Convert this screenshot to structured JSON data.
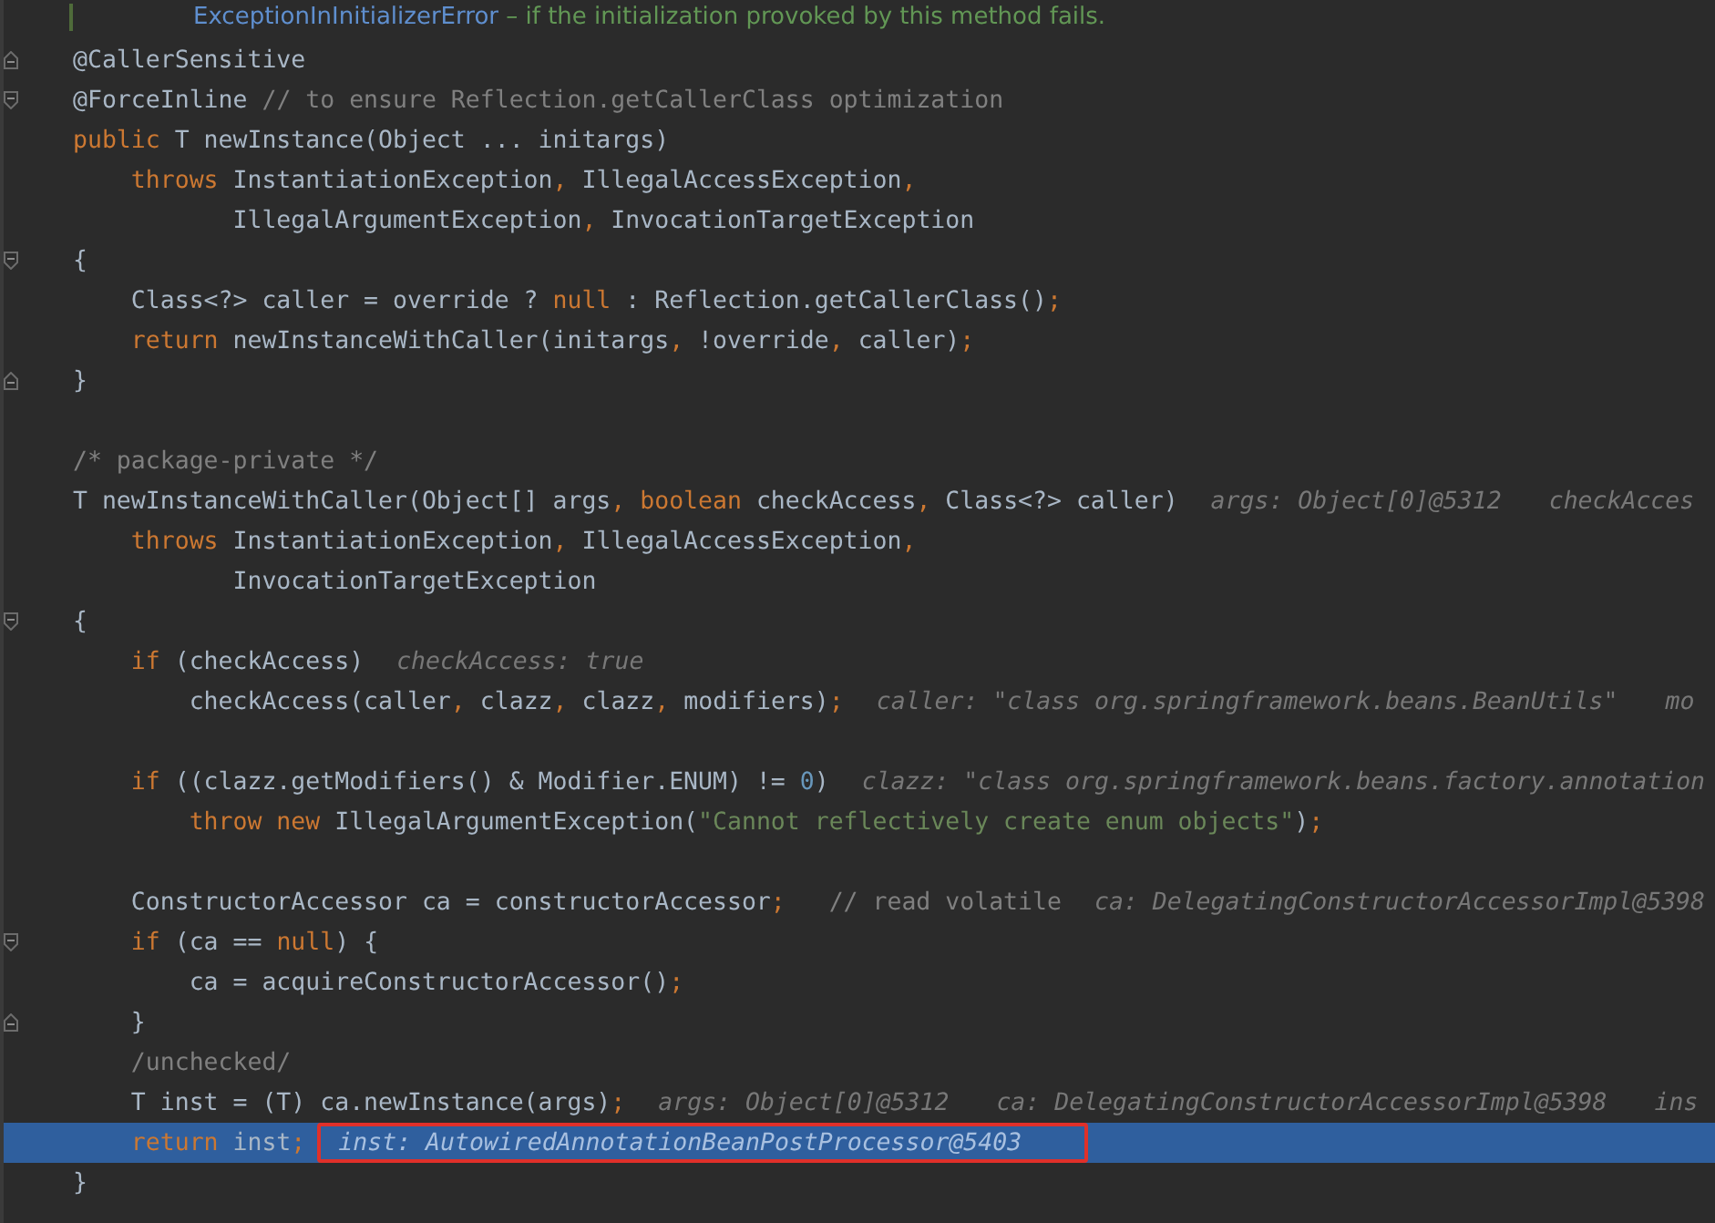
{
  "editor": {
    "lines": [
      {
        "fold_open": false,
        "fold_close": false,
        "current": false,
        "tokens": [
          {
            "kind": "doc-link",
            "text": "ExceptionInInitializerError"
          },
          {
            "kind": "doc-text",
            "text": " – if the initialization provoked by this method fails."
          }
        ]
      },
      {
        "fold_open": false,
        "fold_close": true,
        "current": false,
        "tokens": [
          {
            "kind": "plain",
            "text": "@CallerSensitive"
          }
        ]
      },
      {
        "fold_open": true,
        "fold_close": false,
        "current": false,
        "tokens": [
          {
            "kind": "plain",
            "text": "@ForceInline "
          },
          {
            "kind": "comment",
            "text": "// to ensure Reflection.getCallerClass optimization"
          }
        ]
      },
      {
        "fold_open": false,
        "fold_close": false,
        "current": false,
        "tokens": [
          {
            "kind": "keyword",
            "text": "public "
          },
          {
            "kind": "plain",
            "text": "T newInstance(Object ... initargs)"
          }
        ]
      },
      {
        "fold_open": false,
        "fold_close": false,
        "current": false,
        "tokens": [
          {
            "kind": "keyword",
            "text": "    throws "
          },
          {
            "kind": "plain",
            "text": "InstantiationException"
          },
          {
            "kind": "keyword",
            "text": ", "
          },
          {
            "kind": "plain",
            "text": "IllegalAccessException"
          },
          {
            "kind": "keyword",
            "text": ","
          }
        ]
      },
      {
        "fold_open": false,
        "fold_close": false,
        "current": false,
        "tokens": [
          {
            "kind": "plain",
            "text": "           IllegalArgumentException"
          },
          {
            "kind": "keyword",
            "text": ", "
          },
          {
            "kind": "plain",
            "text": "InvocationTargetException"
          }
        ]
      },
      {
        "fold_open": true,
        "fold_close": false,
        "current": false,
        "tokens": [
          {
            "kind": "plain",
            "text": "{"
          }
        ]
      },
      {
        "fold_open": false,
        "fold_close": false,
        "current": false,
        "tokens": [
          {
            "kind": "plain",
            "text": "    Class<?> caller = override ? "
          },
          {
            "kind": "keyword",
            "text": "null"
          },
          {
            "kind": "plain",
            "text": " : Reflection.getCallerClass()"
          },
          {
            "kind": "keyword",
            "text": ";"
          }
        ]
      },
      {
        "fold_open": false,
        "fold_close": false,
        "current": false,
        "tokens": [
          {
            "kind": "keyword",
            "text": "    return "
          },
          {
            "kind": "plain",
            "text": "newInstanceWithCaller(initargs"
          },
          {
            "kind": "keyword",
            "text": ", "
          },
          {
            "kind": "plain",
            "text": "!override"
          },
          {
            "kind": "keyword",
            "text": ", "
          },
          {
            "kind": "plain",
            "text": "caller)"
          },
          {
            "kind": "keyword",
            "text": ";"
          }
        ]
      },
      {
        "fold_open": false,
        "fold_close": true,
        "current": false,
        "tokens": [
          {
            "kind": "plain",
            "text": "}"
          }
        ]
      },
      {
        "fold_open": false,
        "fold_close": false,
        "current": false
      },
      {
        "fold_open": false,
        "fold_close": false,
        "current": false,
        "tokens": [
          {
            "kind": "comment",
            "text": "/* package-private */"
          }
        ]
      },
      {
        "fold_open": false,
        "fold_close": false,
        "current": false,
        "tokens": [
          {
            "kind": "plain",
            "text": "T newInstanceWithCaller(Object[] args"
          },
          {
            "kind": "keyword",
            "text": ", boolean "
          },
          {
            "kind": "plain",
            "text": "checkAccess"
          },
          {
            "kind": "keyword",
            "text": ", "
          },
          {
            "kind": "plain",
            "text": "Class<?> caller)"
          }
        ],
        "hints": [
          {
            "text": "args: Object[0]@5312",
            "outlined": false
          },
          {
            "text": "checkAcces",
            "outlined": false
          }
        ]
      },
      {
        "fold_open": false,
        "fold_close": false,
        "current": false,
        "tokens": [
          {
            "kind": "keyword",
            "text": "    throws "
          },
          {
            "kind": "plain",
            "text": "InstantiationException"
          },
          {
            "kind": "keyword",
            "text": ", "
          },
          {
            "kind": "plain",
            "text": "IllegalAccessException"
          },
          {
            "kind": "keyword",
            "text": ","
          }
        ]
      },
      {
        "fold_open": false,
        "fold_close": false,
        "current": false,
        "tokens": [
          {
            "kind": "plain",
            "text": "           InvocationTargetException"
          }
        ]
      },
      {
        "fold_open": true,
        "fold_close": false,
        "current": false,
        "tokens": [
          {
            "kind": "plain",
            "text": "{"
          }
        ]
      },
      {
        "fold_open": false,
        "fold_close": false,
        "current": false,
        "tokens": [
          {
            "kind": "keyword",
            "text": "    if "
          },
          {
            "kind": "plain",
            "text": "(checkAccess)"
          }
        ],
        "hints": [
          {
            "text": "checkAccess: true",
            "outlined": false
          }
        ]
      },
      {
        "fold_open": false,
        "fold_close": false,
        "current": false,
        "tokens": [
          {
            "kind": "plain",
            "text": "        checkAccess(caller"
          },
          {
            "kind": "keyword",
            "text": ", "
          },
          {
            "kind": "plain",
            "text": "clazz"
          },
          {
            "kind": "keyword",
            "text": ", "
          },
          {
            "kind": "plain",
            "text": "clazz"
          },
          {
            "kind": "keyword",
            "text": ", "
          },
          {
            "kind": "plain",
            "text": "modifiers)"
          },
          {
            "kind": "keyword",
            "text": ";"
          }
        ],
        "hints": [
          {
            "text": "caller: \"class org.springframework.beans.BeanUtils\"",
            "outlined": false
          },
          {
            "text": "mo",
            "outlined": false
          }
        ]
      },
      {
        "fold_open": false,
        "fold_close": false,
        "current": false
      },
      {
        "fold_open": false,
        "fold_close": false,
        "current": false,
        "tokens": [
          {
            "kind": "keyword",
            "text": "    if "
          },
          {
            "kind": "plain",
            "text": "((clazz.getModifiers() & Modifier.ENUM) != "
          },
          {
            "kind": "number",
            "text": "0"
          },
          {
            "kind": "plain",
            "text": ")"
          }
        ],
        "hints": [
          {
            "text": "clazz: \"class org.springframework.beans.factory.annotation",
            "outlined": false
          }
        ]
      },
      {
        "fold_open": false,
        "fold_close": false,
        "current": false,
        "tokens": [
          {
            "kind": "keyword",
            "text": "        throw new "
          },
          {
            "kind": "plain",
            "text": "IllegalArgumentException("
          },
          {
            "kind": "string",
            "text": "\"Cannot reflectively create enum objects\""
          },
          {
            "kind": "plain",
            "text": ")"
          },
          {
            "kind": "keyword",
            "text": ";"
          }
        ]
      },
      {
        "fold_open": false,
        "fold_close": false,
        "current": false
      },
      {
        "fold_open": false,
        "fold_close": false,
        "current": false,
        "tokens": [
          {
            "kind": "plain",
            "text": "    ConstructorAccessor ca = constructorAccessor"
          },
          {
            "kind": "keyword",
            "text": ";"
          },
          {
            "kind": "comment",
            "text": "   // read volatile"
          }
        ],
        "hints": [
          {
            "text": "ca: DelegatingConstructorAccessorImpl@5398",
            "outlined": false
          }
        ]
      },
      {
        "fold_open": true,
        "fold_close": false,
        "current": false,
        "tokens": [
          {
            "kind": "keyword",
            "text": "    if "
          },
          {
            "kind": "plain",
            "text": "(ca == "
          },
          {
            "kind": "keyword",
            "text": "null"
          },
          {
            "kind": "plain",
            "text": ") {"
          }
        ]
      },
      {
        "fold_open": false,
        "fold_close": false,
        "current": false,
        "tokens": [
          {
            "kind": "plain",
            "text": "        ca = acquireConstructorAccessor()"
          },
          {
            "kind": "keyword",
            "text": ";"
          }
        ]
      },
      {
        "fold_open": false,
        "fold_close": true,
        "current": false,
        "tokens": [
          {
            "kind": "plain",
            "text": "    }"
          }
        ]
      },
      {
        "fold_open": false,
        "fold_close": false,
        "current": false,
        "tokens": [
          {
            "kind": "comment",
            "text": "    /unchecked/"
          }
        ]
      },
      {
        "fold_open": false,
        "fold_close": false,
        "current": false,
        "tokens": [
          {
            "kind": "plain",
            "text": "    T inst = (T) ca.newInstance(args)"
          },
          {
            "kind": "keyword",
            "text": ";"
          }
        ],
        "hints": [
          {
            "text": "args: Object[0]@5312",
            "outlined": false
          },
          {
            "text": "ca: DelegatingConstructorAccessorImpl@5398",
            "outlined": false
          },
          {
            "text": "ins",
            "outlined": false
          }
        ]
      },
      {
        "fold_open": false,
        "fold_close": false,
        "current": true,
        "tokens": [
          {
            "kind": "keyword",
            "text": "    return "
          },
          {
            "kind": "plain",
            "text": "inst"
          },
          {
            "kind": "keyword",
            "text": ";"
          }
        ],
        "hints": [
          {
            "text": "inst: AutowiredAnnotationBeanPostProcessor@5403",
            "outlined": true
          }
        ]
      },
      {
        "fold_open": false,
        "fold_close": false,
        "current": false,
        "tokens": [
          {
            "kind": "plain",
            "text": "}"
          }
        ]
      }
    ]
  }
}
